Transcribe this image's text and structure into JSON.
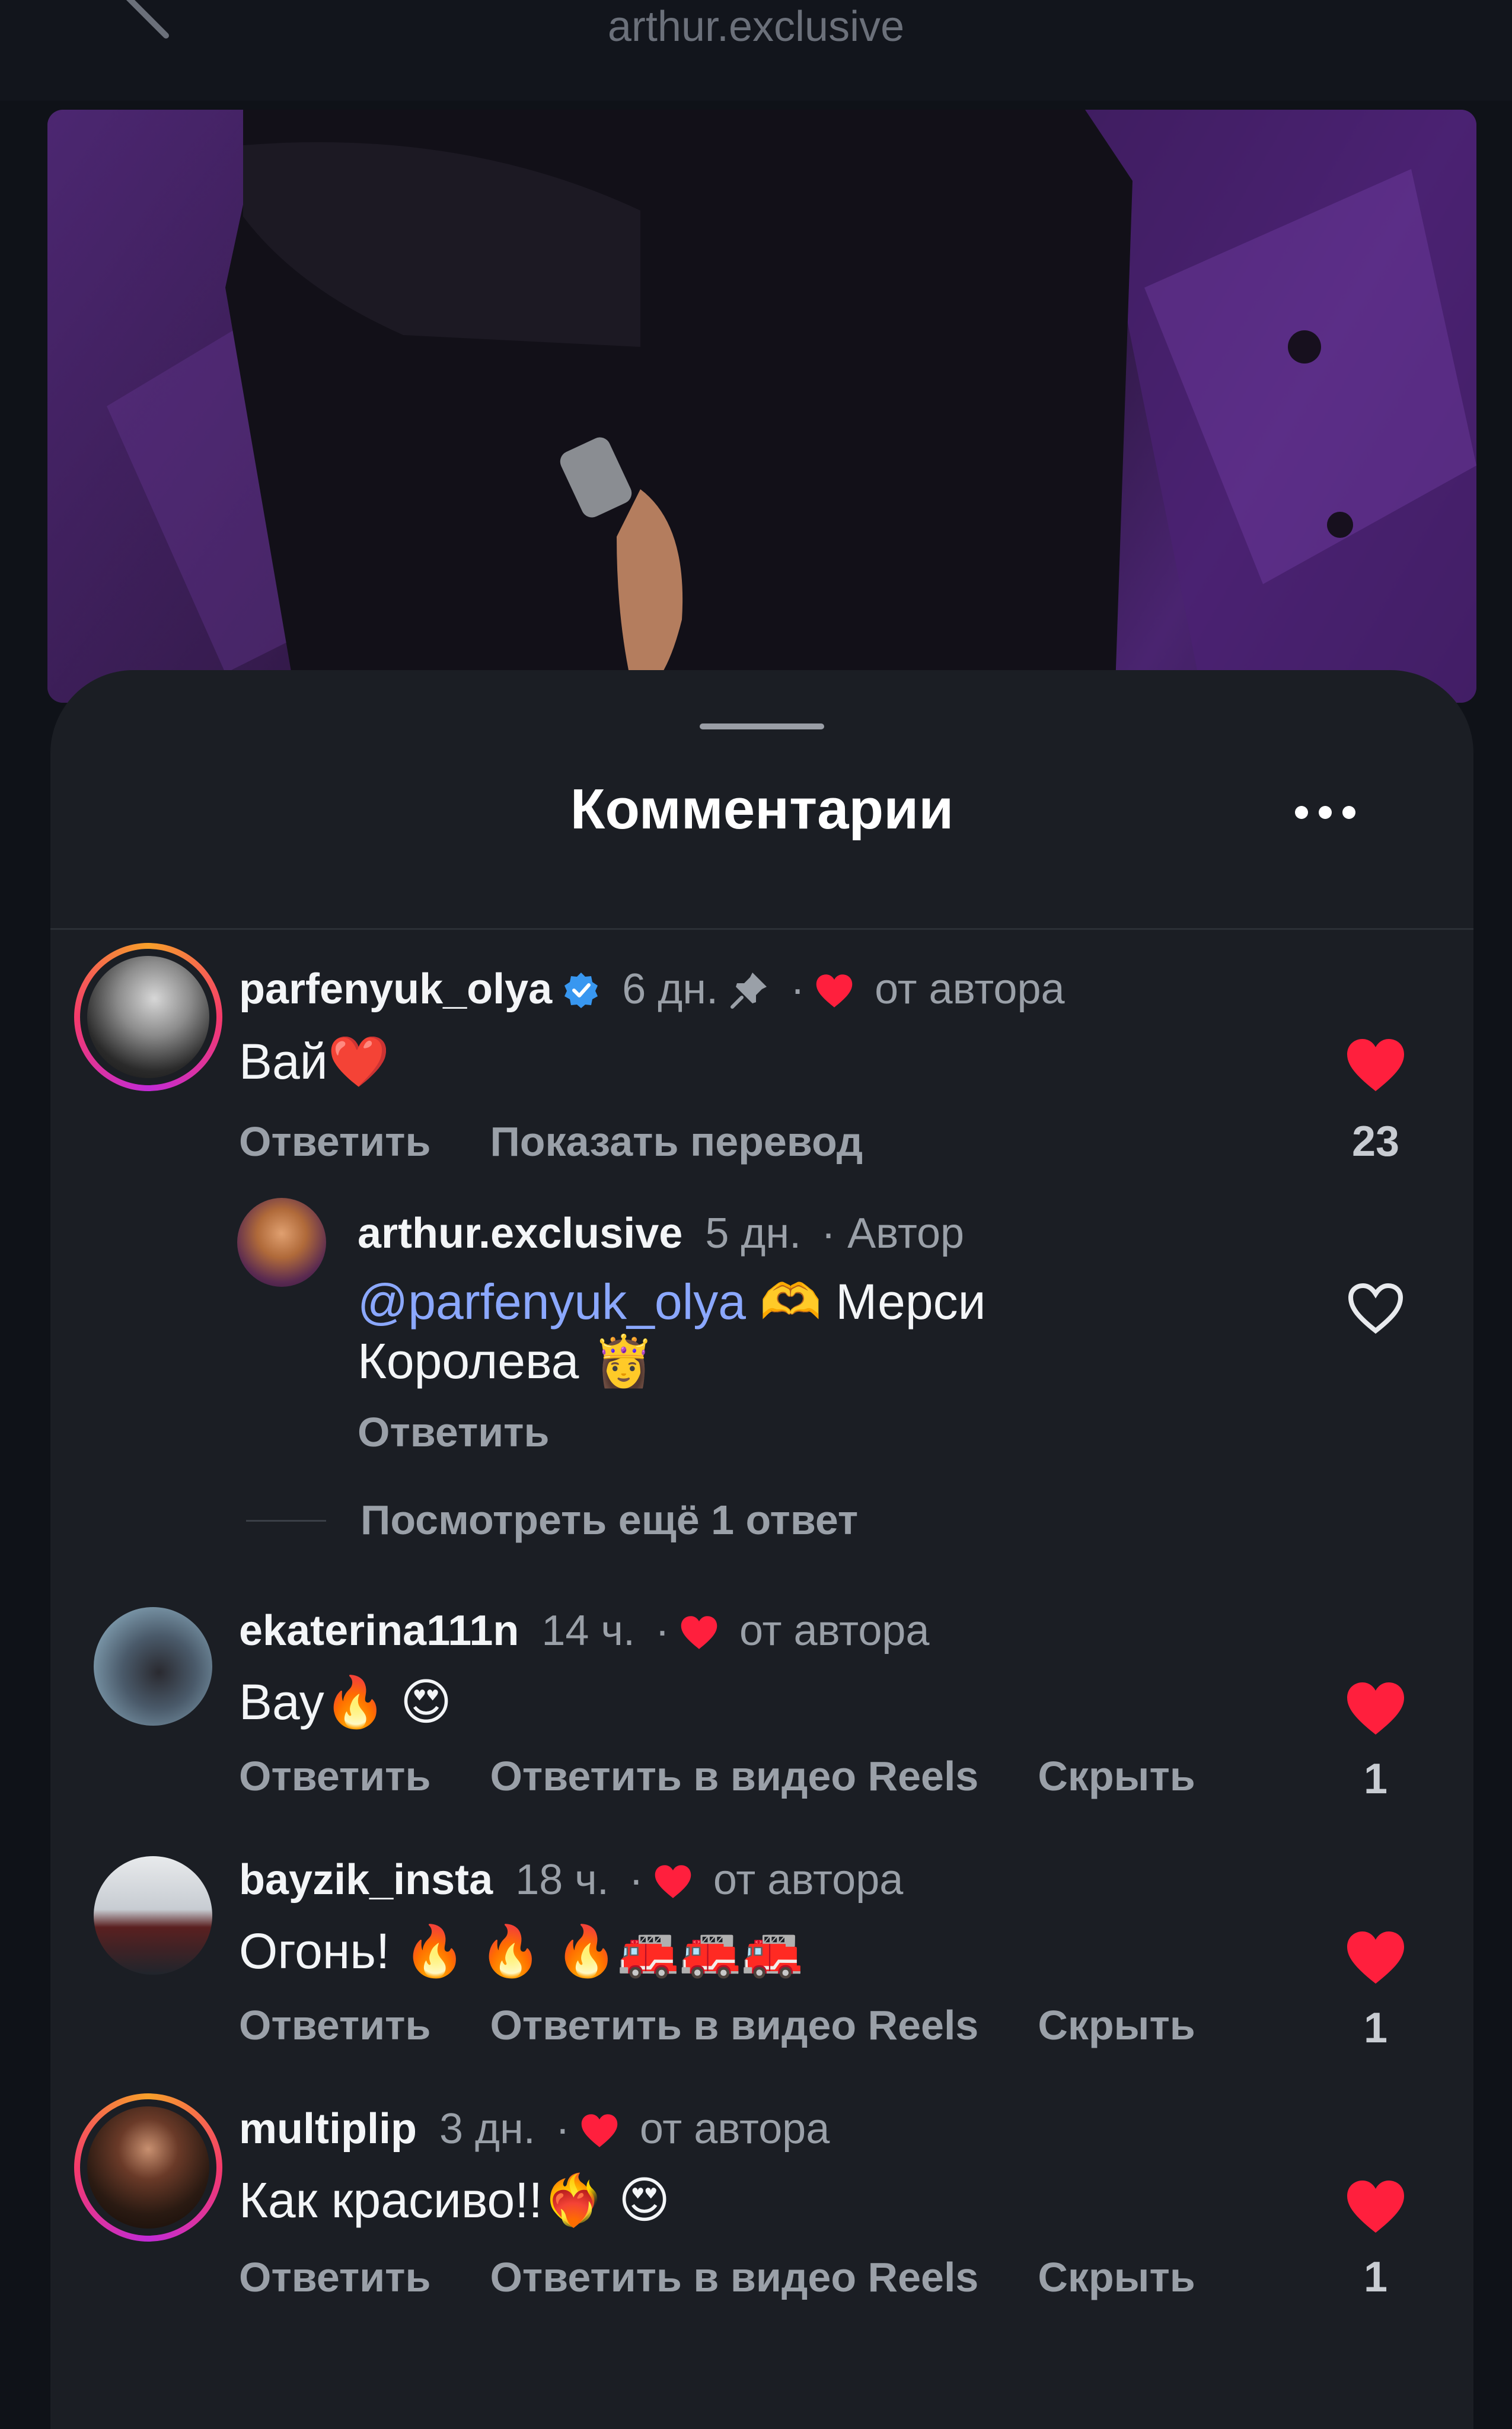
{
  "header": {
    "title": "arthur.exclusive"
  },
  "sheet": {
    "title": "Комментарии"
  },
  "colors": {
    "accent_heart": "#ff1f3d",
    "mention": "#8ba8ff",
    "background": "#1b1e24"
  },
  "comments": [
    {
      "username": "parfenyuk_olya",
      "verified": true,
      "time": "6 дн.",
      "pinned": true,
      "author_like": "от автора",
      "text": "Вай❤️",
      "actions": [
        "Ответить",
        "Показать перевод"
      ],
      "likes": "23",
      "liked": true
    },
    {
      "username": "ekaterina111n",
      "time": "14 ч.",
      "author_like": "от автора",
      "text": "Вау🔥 😍",
      "actions": [
        "Ответить",
        "Ответить в видео Reels",
        "Скрыть"
      ],
      "likes": "1",
      "liked": true
    },
    {
      "username": "bayzik_insta",
      "time": "18 ч.",
      "author_like": "от автора",
      "text": "Огонь! 🔥 🔥 🔥🚒🚒🚒",
      "actions": [
        "Ответить",
        "Ответить в видео Reels",
        "Скрыть"
      ],
      "likes": "1",
      "liked": true
    },
    {
      "username": "multiplip",
      "time": "3 дн.",
      "author_like": "от автора",
      "text": "Как красиво!!❤️‍🔥 😍",
      "actions": [
        "Ответить",
        "Ответить в видео Reels",
        "Скрыть"
      ],
      "likes": "1",
      "liked": true
    }
  ],
  "reply": {
    "username": "arthur.exclusive",
    "time": "5 дн.",
    "role": "· Автор",
    "mention": "@parfenyuk_olya",
    "text_line1": " 🫶 Мерси",
    "text_line2": "Королева 👸",
    "action": "Ответить",
    "liked": false
  },
  "view_more_replies": "Посмотреть ещё 1 ответ",
  "separator_dot": "·"
}
